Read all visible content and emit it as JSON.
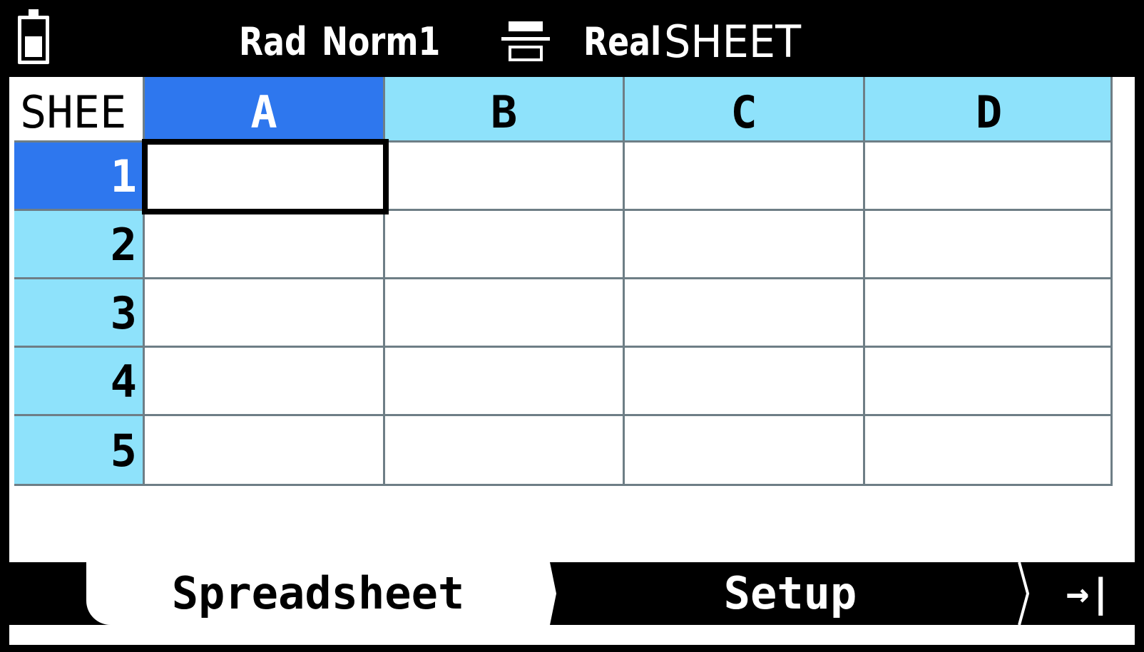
{
  "status_bar": {
    "angle_unit": "Rad",
    "display_format": "Norm1",
    "complex_mode": "Real",
    "app_name": "SHEET"
  },
  "sheet": {
    "corner_label": "SHEE",
    "columns": [
      "A",
      "B",
      "C",
      "D"
    ],
    "rows": [
      "1",
      "2",
      "3",
      "4",
      "5"
    ],
    "selected_cell": "A1"
  },
  "function_bar": {
    "tab_spreadsheet": "Spreadsheet",
    "tab_setup": "Setup",
    "more_icon": "→|"
  },
  "colors": {
    "header_bg": "#8ee2fb",
    "selected_bg": "#2e77ee",
    "grid_line": "#6e7e86"
  }
}
